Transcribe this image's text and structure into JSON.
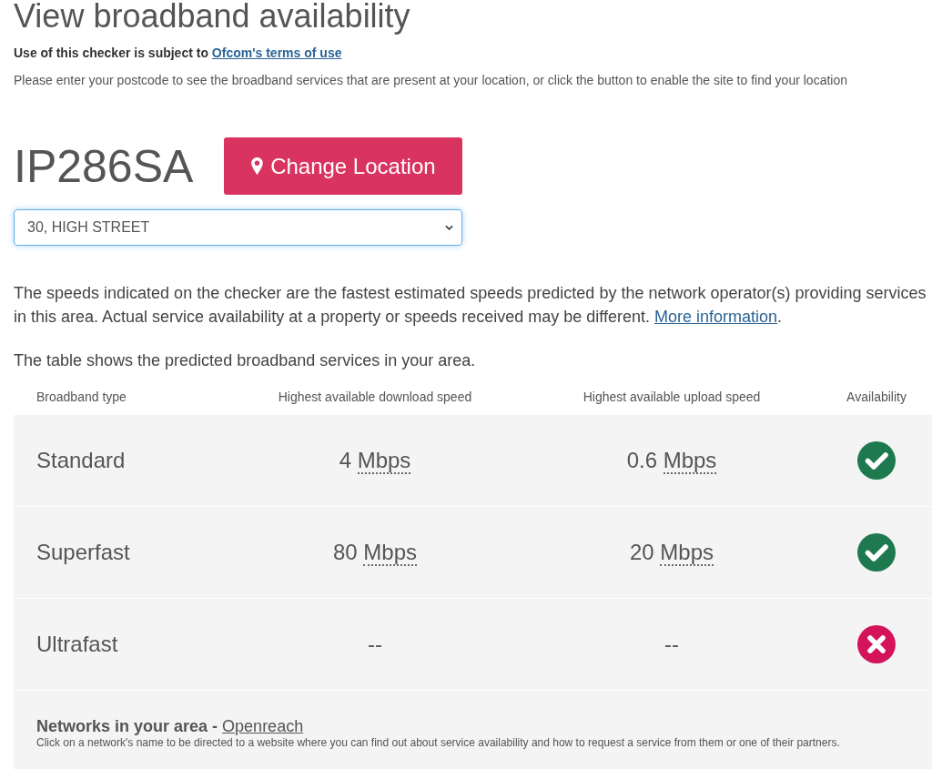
{
  "page": {
    "title": "View broadband availability"
  },
  "terms": {
    "text": "Use of this checker is subject to",
    "link": "Ofcom's terms of use"
  },
  "instructions": "Please enter your postcode to see the broadband services that are present at your location, or click the button to enable the site to find your location",
  "location": {
    "postcode": "IP286SA",
    "button": "Change Location",
    "address": "30, HIGH STREET"
  },
  "disclaimer": {
    "text": "The speeds indicated on the checker are the fastest estimated speeds predicted by the network operator(s) providing services in this area. Actual service availability at a property or speeds received may be different.",
    "link": "More information",
    "after": "."
  },
  "table_intro": "The table shows the predicted broadband services in your area.",
  "table": {
    "columns": [
      "Broadband type",
      "Highest available download speed",
      "Highest available upload speed",
      "Availability"
    ],
    "rows": [
      {
        "type": "Standard",
        "download": {
          "value": "4",
          "unit": "Mbps"
        },
        "upload": {
          "value": "0.6",
          "unit": "Mbps"
        },
        "available": true
      },
      {
        "type": "Superfast",
        "download": {
          "value": "80",
          "unit": "Mbps"
        },
        "upload": {
          "value": "20",
          "unit": "Mbps"
        },
        "available": true
      },
      {
        "type": "Ultrafast",
        "download": {
          "value": "--"
        },
        "upload": {
          "value": "--"
        },
        "available": false
      }
    ]
  },
  "networks": {
    "label": "Networks in your area -",
    "link": "Openreach",
    "note": "Click on a network's name to be directed to a website where you can find out about service availability and how to request a service from them or one of their partners."
  }
}
